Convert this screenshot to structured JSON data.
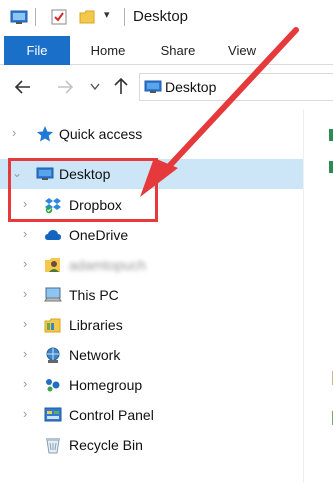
{
  "titlebar": {
    "title": "Desktop",
    "icons": [
      "explorer-window-icon",
      "properties-checkmark-icon",
      "new-folder-icon",
      "dropdown-arrow-icon"
    ]
  },
  "ribbon": {
    "tabs": [
      {
        "label": "File",
        "active": true
      },
      {
        "label": "Home"
      },
      {
        "label": "Share"
      },
      {
        "label": "View"
      }
    ]
  },
  "address_bar": {
    "path": "Desktop",
    "icons": [
      "back-arrow-icon",
      "forward-arrow-icon",
      "recent-dropdown-icon",
      "up-arrow-icon",
      "desktop-icon"
    ]
  },
  "nav_pane": {
    "items": [
      {
        "label": "Quick access",
        "icon": "star-icon",
        "expanded": false
      },
      {
        "label": "Desktop",
        "icon": "desktop-icon",
        "expanded": true,
        "selected": true
      },
      {
        "label": "Dropbox",
        "icon": "dropbox-icon",
        "expanded": false,
        "highlighted": true
      },
      {
        "label": "OneDrive",
        "icon": "cloud-icon",
        "expanded": false
      },
      {
        "label": "adamtopuch",
        "icon": "user-folder-icon",
        "expanded": false,
        "blurred": true
      },
      {
        "label": "This PC",
        "icon": "computer-icon",
        "expanded": false
      },
      {
        "label": "Libraries",
        "icon": "libraries-icon",
        "expanded": false
      },
      {
        "label": "Network",
        "icon": "network-icon",
        "expanded": false
      },
      {
        "label": "Homegroup",
        "icon": "homegroup-icon",
        "expanded": false
      },
      {
        "label": "Control Panel",
        "icon": "control-panel-icon",
        "expanded": false
      },
      {
        "label": "Recycle Bin",
        "icon": "recycle-bin-icon",
        "expanded": false
      }
    ]
  },
  "annotations": {
    "accent": "#e5393b",
    "highlight": "#cce6f7"
  }
}
